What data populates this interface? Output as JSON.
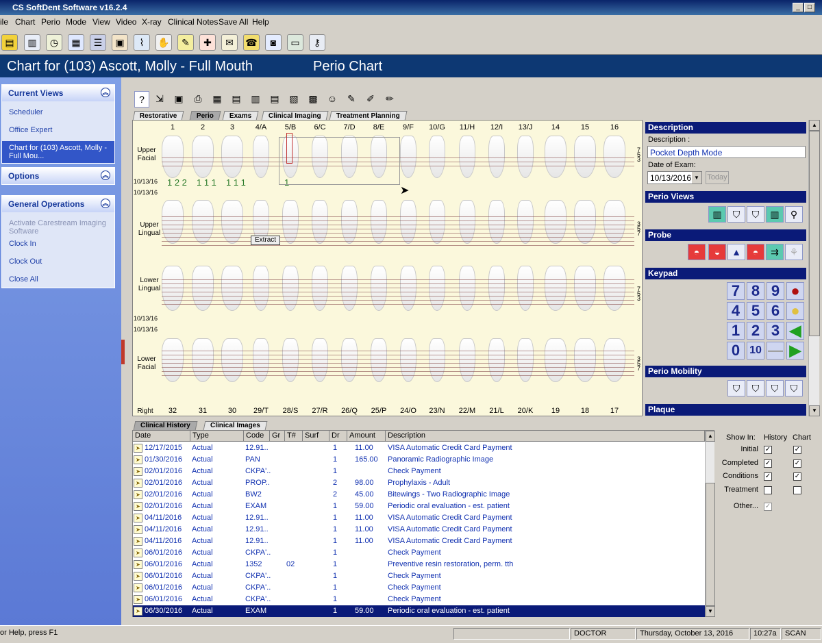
{
  "window": {
    "title": "CS SoftDent Software v16.2.4"
  },
  "menu": [
    "ile",
    "Chart",
    "Perio",
    "Mode",
    "View",
    "Video",
    "X-ray",
    "Clinical Notes",
    "Save All",
    "Help"
  ],
  "header": {
    "patient_title": "Chart for (103) Ascott, Molly - Full Mouth",
    "view_title": "Perio Chart"
  },
  "left_panel": {
    "current_views": {
      "title": "Current Views",
      "items": [
        "Scheduler",
        "Office Expert",
        "Chart for (103) Ascott, Molly - Full Mou..."
      ]
    },
    "options": {
      "title": "Options"
    },
    "general_operations": {
      "title": "General Operations",
      "items": [
        "Activate Carestream Imaging Software",
        "Clock In",
        "Clock Out",
        "Close All"
      ]
    }
  },
  "chart_tabs": [
    "Restorative",
    "Perio",
    "Exams",
    "Clinical Imaging",
    "Treatment Planning"
  ],
  "active_chart_tab": "Perio",
  "upper_teeth": [
    "1",
    "2",
    "3",
    "4/A",
    "5/B",
    "6/C",
    "7/D",
    "8/E",
    "9/F",
    "10/G",
    "11/H",
    "12/I",
    "13/J",
    "14",
    "15",
    "16"
  ],
  "lower_teeth": [
    "32",
    "31",
    "30",
    "29/T",
    "28/S",
    "27/R",
    "26/Q",
    "25/P",
    "24/O",
    "23/N",
    "22/M",
    "21/L",
    "20/K",
    "19",
    "18",
    "17"
  ],
  "row_labels": {
    "upper_facial": "Upper Facial",
    "upper_lingual": "Upper Lingual",
    "lower_lingual": "Lower Lingual",
    "lower_facial": "Lower Facial",
    "right": "Right"
  },
  "exam_dates": {
    "a": "10/13/16",
    "b": "10/13/16",
    "c": "10/13/16",
    "d": "10/13/16"
  },
  "pocket_depths": {
    "t1": "1 2 2",
    "t2": "1 1 1",
    "t3": "1 1 1",
    "t5": "1"
  },
  "scale_right": {
    "upper_facial": [
      "7",
      "5",
      "3"
    ],
    "upper_lingual": [
      "3",
      "5",
      "7"
    ],
    "lower_lingual": [
      "7",
      "5",
      "3"
    ],
    "lower_facial": [
      "3",
      "5",
      "7"
    ]
  },
  "extract_label": "Extract",
  "description": {
    "title": "Description",
    "desc_label": "Description :",
    "desc_value": "Pocket Depth Mode",
    "date_label": "Date of Exam:",
    "date_value": "10/13/2016",
    "today_button": "Today"
  },
  "perio_views": {
    "title": "Perio Views"
  },
  "probe": {
    "title": "Probe"
  },
  "keypad": {
    "title": "Keypad",
    "keys": [
      "7",
      "8",
      "9",
      "4",
      "5",
      "6",
      "1",
      "2",
      "3",
      "0",
      "10"
    ]
  },
  "perio_mobility": {
    "title": "Perio Mobility"
  },
  "plaque": {
    "title": "Plaque"
  },
  "bottom_tabs": [
    "Clinical History",
    "Clinical Images"
  ],
  "grid": {
    "columns": [
      "Date",
      "Type",
      "Code",
      "Gr",
      "T#",
      "Surf",
      "Dr",
      "Amount",
      "Description"
    ],
    "rows": [
      {
        "date": "12/17/2015",
        "type": "Actual",
        "code": "12.91..",
        "gr": "",
        "tooth": "",
        "surf": "",
        "dr": "1",
        "amount": "11.00",
        "desc": "VISA Automatic Credit Card Payment"
      },
      {
        "date": "01/30/2016",
        "type": "Actual",
        "code": "PAN",
        "gr": "",
        "tooth": "",
        "surf": "",
        "dr": "1",
        "amount": "165.00",
        "desc": "Panoramic Radiographic Image"
      },
      {
        "date": "02/01/2016",
        "type": "Actual",
        "code": "CKPA'..",
        "gr": "",
        "tooth": "",
        "surf": "",
        "dr": "1",
        "amount": "",
        "desc": "Check Payment"
      },
      {
        "date": "02/01/2016",
        "type": "Actual",
        "code": "PROP..",
        "gr": "",
        "tooth": "",
        "surf": "",
        "dr": "2",
        "amount": "98.00",
        "desc": "Prophylaxis - Adult"
      },
      {
        "date": "02/01/2016",
        "type": "Actual",
        "code": "BW2",
        "gr": "",
        "tooth": "",
        "surf": "",
        "dr": "2",
        "amount": "45.00",
        "desc": "Bitewings - Two Radiographic Image"
      },
      {
        "date": "02/01/2016",
        "type": "Actual",
        "code": "EXAM",
        "gr": "",
        "tooth": "",
        "surf": "",
        "dr": "1",
        "amount": "59.00",
        "desc": "Periodic oral evaluation - est. patient"
      },
      {
        "date": "04/11/2016",
        "type": "Actual",
        "code": "12.91..",
        "gr": "",
        "tooth": "",
        "surf": "",
        "dr": "1",
        "amount": "11.00",
        "desc": "VISA Automatic Credit Card Payment"
      },
      {
        "date": "04/11/2016",
        "type": "Actual",
        "code": "12.91..",
        "gr": "",
        "tooth": "",
        "surf": "",
        "dr": "1",
        "amount": "11.00",
        "desc": "VISA Automatic Credit Card Payment"
      },
      {
        "date": "04/11/2016",
        "type": "Actual",
        "code": "12.91..",
        "gr": "",
        "tooth": "",
        "surf": "",
        "dr": "1",
        "amount": "11.00",
        "desc": "VISA Automatic Credit Card Payment"
      },
      {
        "date": "06/01/2016",
        "type": "Actual",
        "code": "CKPA'..",
        "gr": "",
        "tooth": "",
        "surf": "",
        "dr": "1",
        "amount": "",
        "desc": "Check Payment"
      },
      {
        "date": "06/01/2016",
        "type": "Actual",
        "code": "1352",
        "gr": "",
        "tooth": "02",
        "surf": "",
        "dr": "1",
        "amount": "",
        "desc": "Preventive resin restoration, perm. tth"
      },
      {
        "date": "06/01/2016",
        "type": "Actual",
        "code": "CKPA'..",
        "gr": "",
        "tooth": "",
        "surf": "",
        "dr": "1",
        "amount": "",
        "desc": "Check Payment"
      },
      {
        "date": "06/01/2016",
        "type": "Actual",
        "code": "CKPA'..",
        "gr": "",
        "tooth": "",
        "surf": "",
        "dr": "1",
        "amount": "",
        "desc": "Check Payment"
      },
      {
        "date": "06/01/2016",
        "type": "Actual",
        "code": "CKPA'..",
        "gr": "",
        "tooth": "",
        "surf": "",
        "dr": "1",
        "amount": "",
        "desc": "Check Payment"
      },
      {
        "date": "06/30/2016",
        "type": "Actual",
        "code": "EXAM",
        "gr": "",
        "tooth": "",
        "surf": "",
        "dr": "1",
        "amount": "59.00",
        "desc": "Periodic oral evaluation - est. patient"
      }
    ],
    "selected_row": 14
  },
  "show_in": {
    "header": "Show In:",
    "history_col": "History",
    "chart_col": "Chart",
    "rows": [
      {
        "label": "Initial",
        "history": true,
        "chart": true
      },
      {
        "label": "Completed",
        "history": true,
        "chart": true
      },
      {
        "label": "Conditions",
        "history": true,
        "chart": true
      },
      {
        "label": "Treatment",
        "history": false,
        "chart": false
      },
      {
        "label": "Other...",
        "history": true,
        "chart": null
      }
    ]
  },
  "status": {
    "help": "or Help, press F1",
    "user": "DOCTOR",
    "date": "Thursday, October 13, 2016",
    "time": "10:27a",
    "mode": "SCAN"
  },
  "colors": {
    "header_bg": "#0d3873",
    "section_bar": "#0a1a78",
    "chart_bg": "#fbf8dc",
    "grid_text": "#1030b0",
    "left_panel": "#5b79d5"
  }
}
